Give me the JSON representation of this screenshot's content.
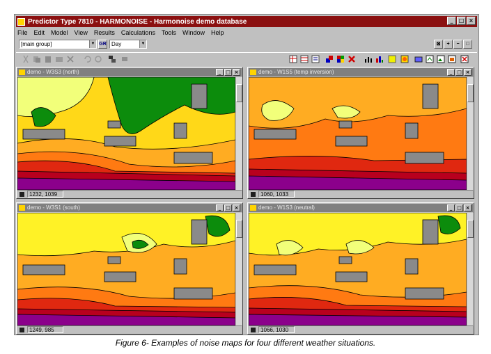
{
  "app": {
    "title": "Predictor Type 7810 - HARMONOISE - Harmonoise demo database",
    "window_buttons": [
      "_",
      "□",
      "×"
    ]
  },
  "menu": [
    "File",
    "Edit",
    "Model",
    "View",
    "Results",
    "Calculations",
    "Tools",
    "Window",
    "Help"
  ],
  "toolbar": {
    "group_select": "[main group]",
    "group_button": "GR",
    "period_select": "Day"
  },
  "colors": {
    "contour_1": "#8b008b",
    "contour_2": "#b8001e",
    "contour_3": "#e02810",
    "contour_4": "#ff7a12",
    "contour_5": "#ffac22",
    "contour_6": "#ffd818",
    "contour_7": "#fff226",
    "contour_8": "#f2ff7a",
    "contour_9": "#0c8c0c",
    "building": "#8a8a8a"
  },
  "windows": [
    {
      "title": "demo - W3S3 (north)",
      "coords": "1232, 1039"
    },
    {
      "title": "demo - W1S5 (temp inversion)",
      "coords": "1060, 1033"
    },
    {
      "title": "demo - W3S1 (south)",
      "coords": "1249, 985"
    },
    {
      "title": "demo - W1S3 (neutral)",
      "coords": "1066, 1030"
    }
  ],
  "caption": "Figure 6- Examples of noise maps for four different weather situations."
}
